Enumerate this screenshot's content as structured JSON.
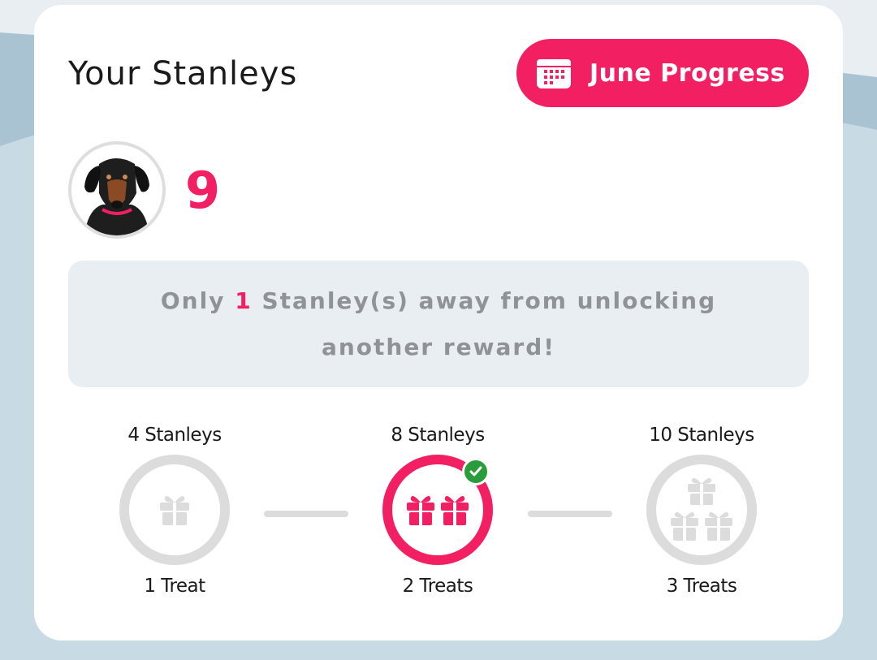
{
  "header": {
    "title": "Your Stanleys",
    "month_button_label": "June Progress"
  },
  "stanley_count": "9",
  "notice": {
    "prefix": "Only",
    "remaining": "1",
    "suffix": "Stanley(s) away from unlocking another reward!"
  },
  "tiers": [
    {
      "stanleys_label": "4 Stanleys",
      "reward_label": "1 Treat",
      "gifts": 1,
      "unlocked": false
    },
    {
      "stanleys_label": "8 Stanleys",
      "reward_label": "2 Treats",
      "gifts": 2,
      "unlocked": true
    },
    {
      "stanleys_label": "10 Stanleys",
      "reward_label": "3 Treats",
      "gifts": 3,
      "unlocked": false
    }
  ],
  "colors": {
    "accent": "#f21f63",
    "inactive": "#dcdcdc",
    "check": "#2a9d3a",
    "notice_bg": "#e9eef2"
  },
  "icons": {
    "calendar": "calendar-icon",
    "gift": "gift-icon",
    "check": "check-icon",
    "avatar": "dachshund-avatar"
  }
}
